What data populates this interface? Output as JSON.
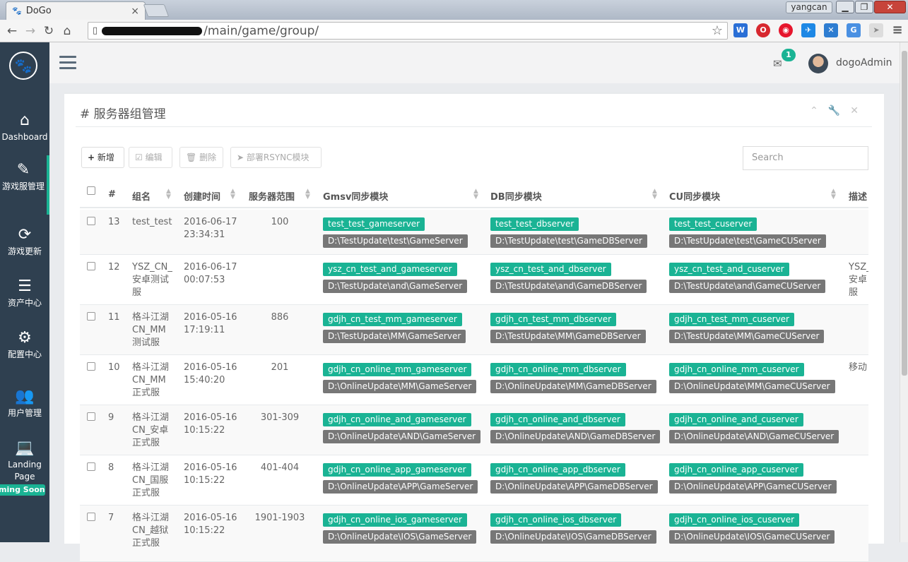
{
  "browser": {
    "tab_title": "DoGo",
    "tab_close": "×",
    "url_suffix": "/main/game/group/",
    "user_chip": "yangcan"
  },
  "sidebar": {
    "items": [
      {
        "label": "Dashboard",
        "icon": "home-icon"
      },
      {
        "label": "游戏服管理",
        "icon": "edit-icon"
      },
      {
        "label": "游戏更新",
        "icon": "refresh-icon"
      },
      {
        "label": "资产中心",
        "icon": "database-icon"
      },
      {
        "label": "配置中心",
        "icon": "gears-icon"
      },
      {
        "label": "用户管理",
        "icon": "users-icon"
      },
      {
        "label": "Landing Page",
        "icon": "laptop-icon"
      }
    ],
    "coming_soon": "ming Soon"
  },
  "topbar": {
    "mail_count": "1",
    "username": "dogoAdmin"
  },
  "panel": {
    "title": "# 服务器组管理",
    "buttons": {
      "add": "新增",
      "edit": "编辑",
      "delete": "删除",
      "deploy": "部署RSYNC模块"
    },
    "search_placeholder": "Search"
  },
  "table": {
    "headers": {
      "id": "#",
      "name": "组名",
      "created": "创建时间",
      "range": "服务器范围",
      "gmsv": "Gmsv同步模块",
      "db": "DB同步模块",
      "cu": "CU同步模块",
      "desc": "描述"
    },
    "rows": [
      {
        "id": "13",
        "name": [
          "test_test"
        ],
        "date": "2016-06-17",
        "time": "23:34:31",
        "range": "100",
        "gmsv": "test_test_gameserver",
        "gmsv_path": "D:\\TestUpdate\\test\\GameServer",
        "db": "test_test_dbserver",
        "db_path": "D:\\TestUpdate\\test\\GameDBServer",
        "cu": "test_test_cuserver",
        "cu_path": "D:\\TestUpdate\\test\\GameCUServer",
        "desc": []
      },
      {
        "id": "12",
        "name": [
          "YSZ_CN_",
          "安卓测试",
          "服"
        ],
        "date": "2016-06-17",
        "time": "00:07:53",
        "range": "",
        "gmsv": "ysz_cn_test_and_gameserver",
        "gmsv_path": "D:\\TestUpdate\\and\\GameServer",
        "db": "ysz_cn_test_and_dbserver",
        "db_path": "D:\\TestUpdate\\and\\GameDBServer",
        "cu": "ysz_cn_test_and_cuserver",
        "cu_path": "D:\\TestUpdate\\and\\GameCUServer",
        "desc": [
          "YSZ_",
          "安卓",
          "服"
        ]
      },
      {
        "id": "11",
        "name": [
          "格斗江湖",
          "CN_MM",
          "测试服"
        ],
        "date": "2016-05-16",
        "time": "17:19:11",
        "range": "886",
        "gmsv": "gdjh_cn_test_mm_gameserver",
        "gmsv_path": "D:\\TestUpdate\\MM\\GameServer",
        "db": "gdjh_cn_test_mm_dbserver",
        "db_path": "D:\\TestUpdate\\MM\\GameDBServer",
        "cu": "gdjh_cn_test_mm_cuserver",
        "cu_path": "D:\\TestUpdate\\MM\\GameCUServer",
        "desc": []
      },
      {
        "id": "10",
        "name": [
          "格斗江湖",
          "CN_MM",
          "正式服"
        ],
        "date": "2016-05-16",
        "time": "15:40:20",
        "range": "201",
        "gmsv": "gdjh_cn_online_mm_gameserver",
        "gmsv_path": "D:\\OnlineUpdate\\MM\\GameServer",
        "db": "gdjh_cn_online_mm_dbserver",
        "db_path": "D:\\OnlineUpdate\\MM\\GameDBServer",
        "cu": "gdjh_cn_online_mm_cuserver",
        "cu_path": "D:\\OnlineUpdate\\MM\\GameCUServer",
        "desc": [
          "移动"
        ]
      },
      {
        "id": "9",
        "name": [
          "格斗江湖",
          "CN_安卓",
          "正式服"
        ],
        "date": "2016-05-16",
        "time": "10:15:22",
        "range": "301-309",
        "gmsv": "gdjh_cn_online_and_gameserver",
        "gmsv_path": "D:\\OnlineUpdate\\AND\\GameServer",
        "db": "gdjh_cn_online_and_dbserver",
        "db_path": "D:\\OnlineUpdate\\AND\\GameDBServer",
        "cu": "gdjh_cn_online_and_cuserver",
        "cu_path": "D:\\OnlineUpdate\\AND\\GameCUServer",
        "desc": []
      },
      {
        "id": "8",
        "name": [
          "格斗江湖",
          "CN_国服",
          "正式服"
        ],
        "date": "2016-05-16",
        "time": "10:15:22",
        "range": "401-404",
        "gmsv": "gdjh_cn_online_app_gameserver",
        "gmsv_path": "D:\\OnlineUpdate\\APP\\GameServer",
        "db": "gdjh_cn_online_app_dbserver",
        "db_path": "D:\\OnlineUpdate\\APP\\GameDBServer",
        "cu": "gdjh_cn_online_app_cuserver",
        "cu_path": "D:\\OnlineUpdate\\APP\\GameCUServer",
        "desc": []
      },
      {
        "id": "7",
        "name": [
          "格斗江湖",
          "CN_越狱",
          "正式服"
        ],
        "date": "2016-05-16",
        "time": "10:15:22",
        "range": "1901-1903",
        "gmsv": "gdjh_cn_online_ios_gameserver",
        "gmsv_path": "D:\\OnlineUpdate\\IOS\\GameServer",
        "db": "gdjh_cn_online_ios_dbserver",
        "db_path": "D:\\OnlineUpdate\\IOS\\GameDBServer",
        "cu": "gdjh_cn_online_ios_cuserver",
        "cu_path": "D:\\OnlineUpdate\\IOS\\GameCUServer",
        "desc": []
      }
    ]
  }
}
